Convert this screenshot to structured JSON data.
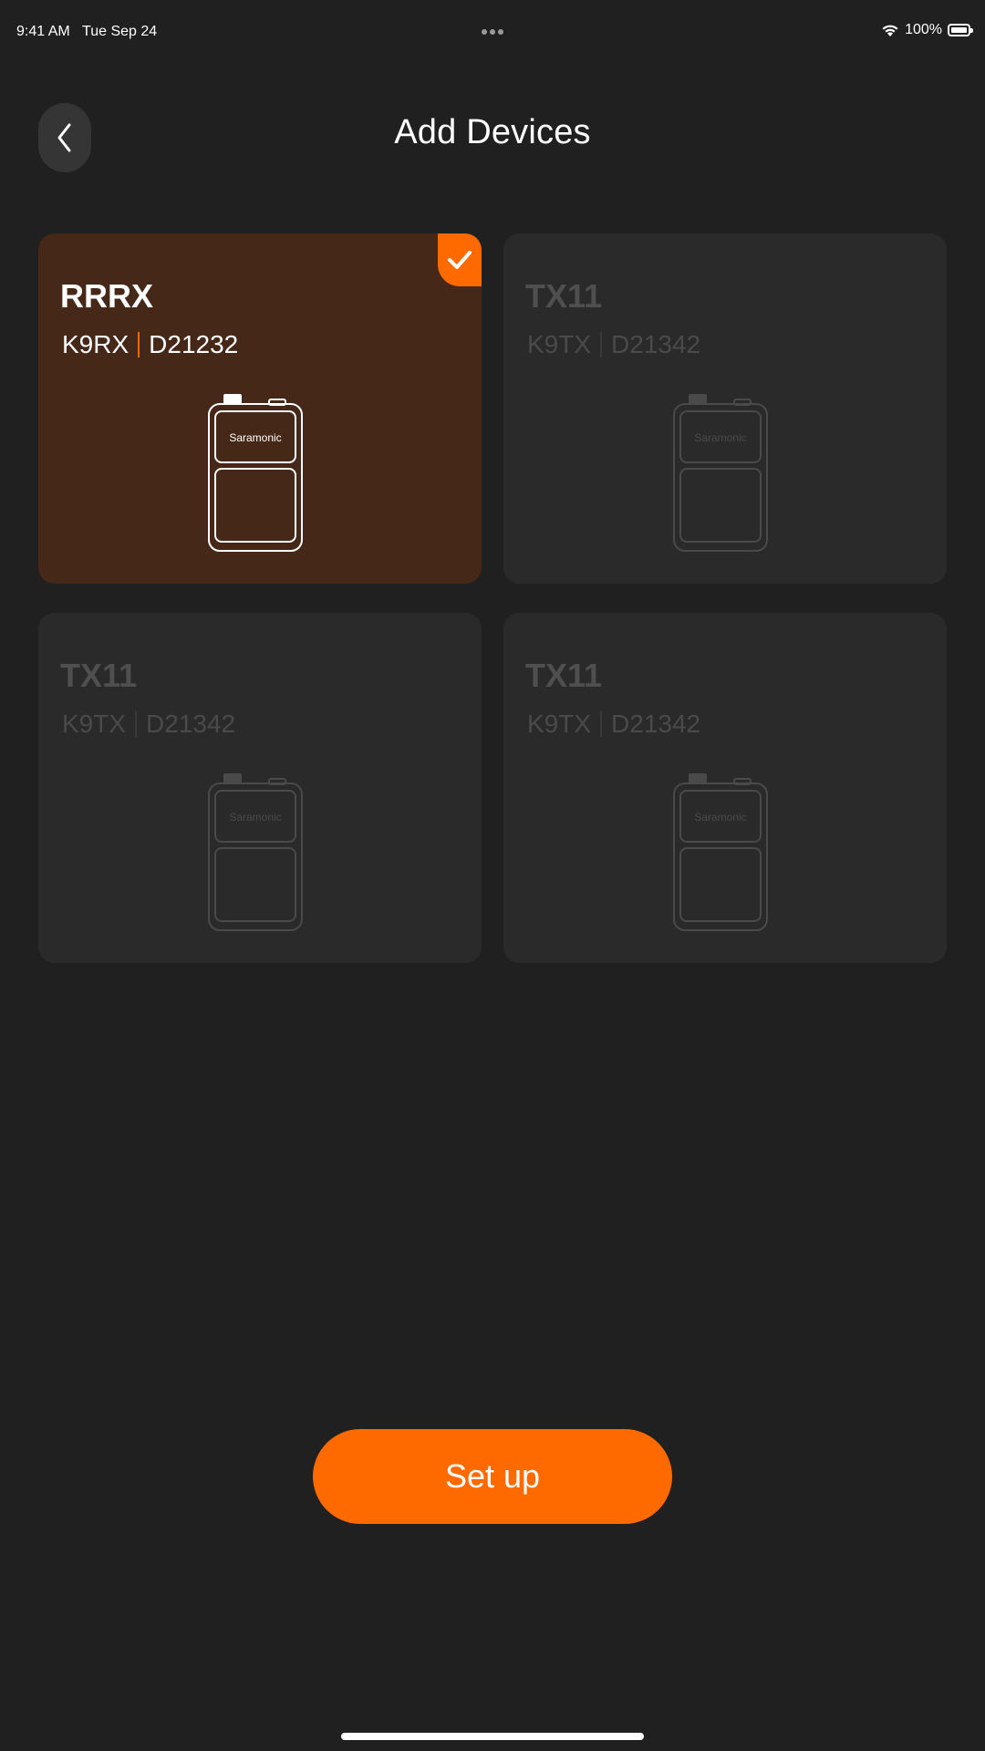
{
  "status_bar": {
    "time": "9:41 AM",
    "date": "Tue Sep 24",
    "battery": "100%"
  },
  "header": {
    "title": "Add Devices",
    "back_icon": "chevron-left-icon"
  },
  "devices": [
    {
      "name": "RRRX",
      "model": "K9RX",
      "serial": "D21232",
      "brand": "Saramonic",
      "selected": true
    },
    {
      "name": "TX11",
      "model": "K9TX",
      "serial": "D21342",
      "brand": "Saramonic",
      "selected": false
    },
    {
      "name": "TX11",
      "model": "K9TX",
      "serial": "D21342",
      "brand": "Saramonic",
      "selected": false
    },
    {
      "name": "TX11",
      "model": "K9TX",
      "serial": "D21342",
      "brand": "Saramonic",
      "selected": false
    }
  ],
  "actions": {
    "setup_label": "Set up"
  },
  "colors": {
    "background": "#202020",
    "accent": "#ff6a00",
    "card": "#2a2a2a",
    "card_selected": "#452817"
  }
}
